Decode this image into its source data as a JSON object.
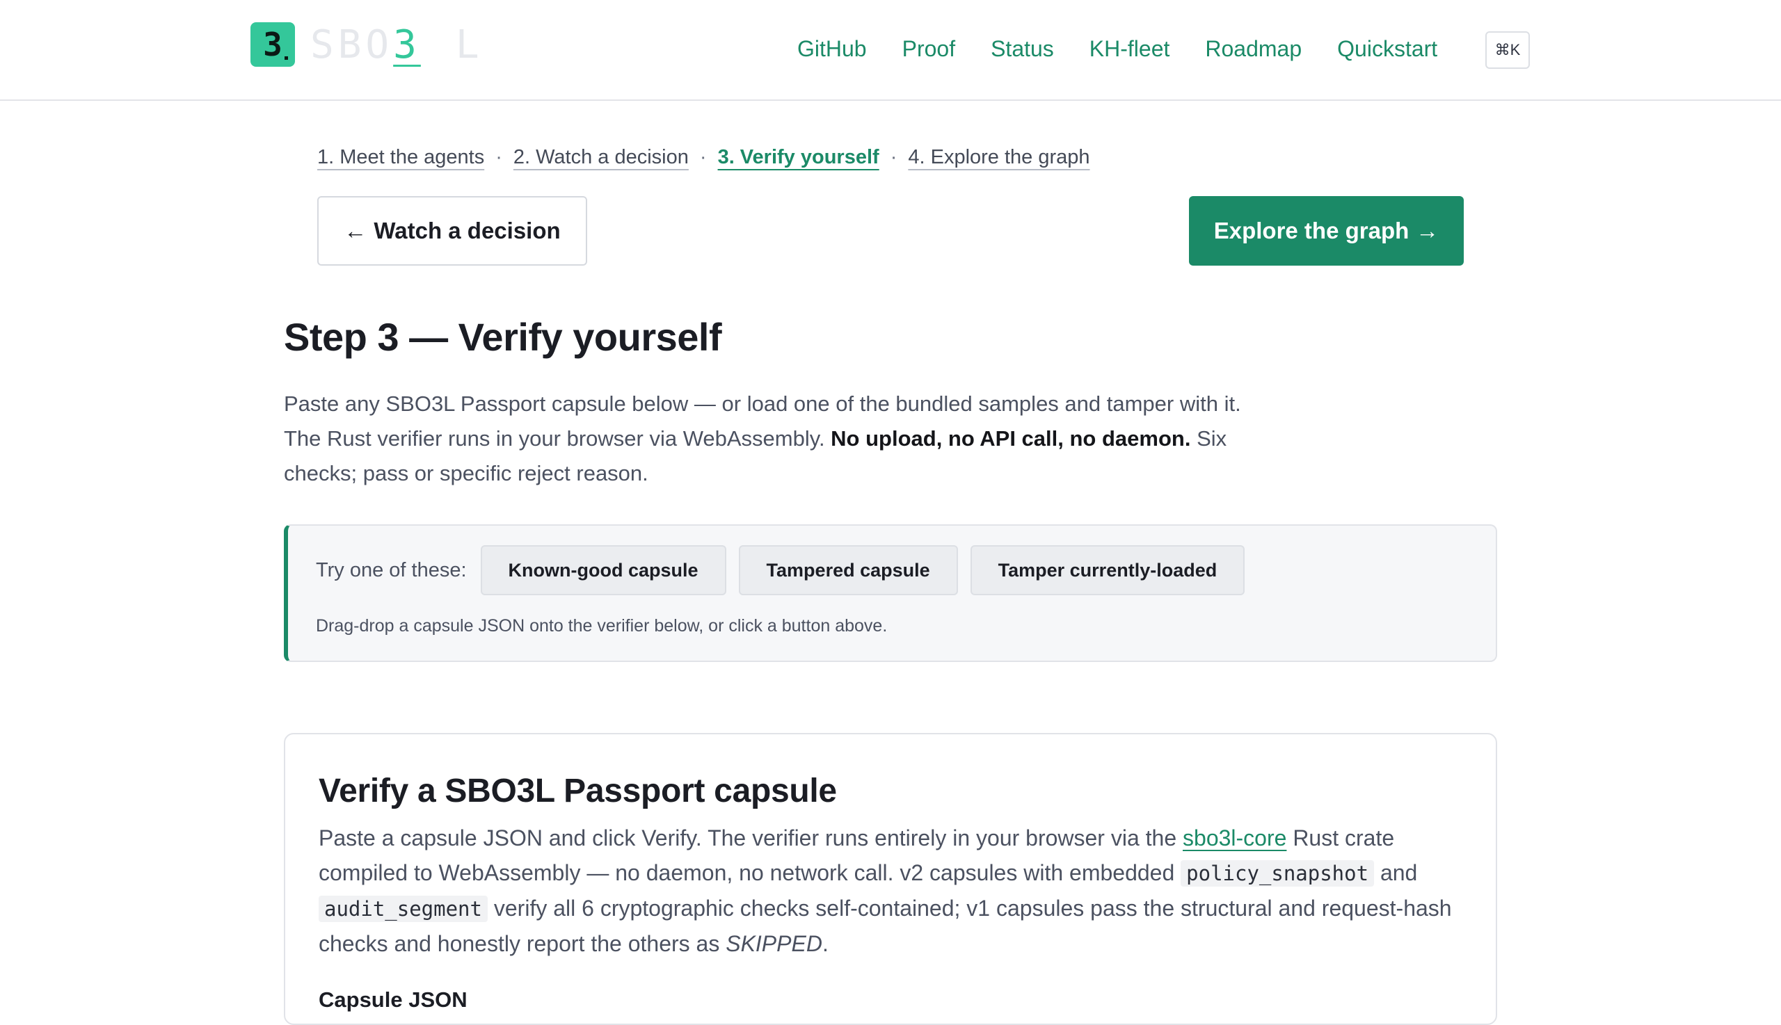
{
  "header": {
    "logo_glyph": "3",
    "logo_word_prefix": "SBO",
    "logo_word_accent": "3",
    "logo_word_suffix": "L",
    "nav": [
      "GitHub",
      "Proof",
      "Status",
      "KH-fleet",
      "Roadmap",
      "Quickstart"
    ],
    "search_shortcut": "⌘K"
  },
  "steps": {
    "items": [
      "1. Meet the agents",
      "2. Watch a decision",
      "3. Verify yourself",
      "4. Explore the graph"
    ],
    "current_index": 2,
    "separator": "·"
  },
  "pager": {
    "prev_arrow": "←",
    "prev_label": "Watch a decision",
    "next_label": "Explore the graph",
    "next_arrow": "→"
  },
  "step_title": "Step 3 — Verify yourself",
  "intro": {
    "text_1": "Paste any SBO3L Passport capsule below — or load one of the bundled samples and tamper with it. The Rust verifier runs in your browser via WebAssembly. ",
    "strong": "No upload, no API call, no daemon.",
    "text_2": " Six checks; pass or specific reject reason."
  },
  "samples": {
    "label": "Try one of these:",
    "buttons": [
      "Known-good capsule",
      "Tampered capsule",
      "Tamper currently-loaded"
    ],
    "hint": "Drag-drop a capsule JSON onto the verifier below, or click a button above."
  },
  "verifier": {
    "title": "Verify a SBO3L Passport capsule",
    "desc_1": "Paste a capsule JSON and click Verify. The verifier runs entirely in your browser via the ",
    "link": "sbo3l-core",
    "desc_2": " Rust crate compiled to WebAssembly — no daemon, no network call. v2 capsules with embedded ",
    "code_1": "policy_snapshot",
    "desc_3": " and ",
    "code_2": "audit_segment",
    "desc_4": " verify all 6 cryptographic checks self-contained; v1 capsules pass the structural and request-hash checks and honestly report the others as ",
    "em": "SKIPPED",
    "desc_5": ".",
    "field_label": "Capsule JSON"
  },
  "colors": {
    "accent": "#1b8a67",
    "logo_green": "#34c79a"
  }
}
